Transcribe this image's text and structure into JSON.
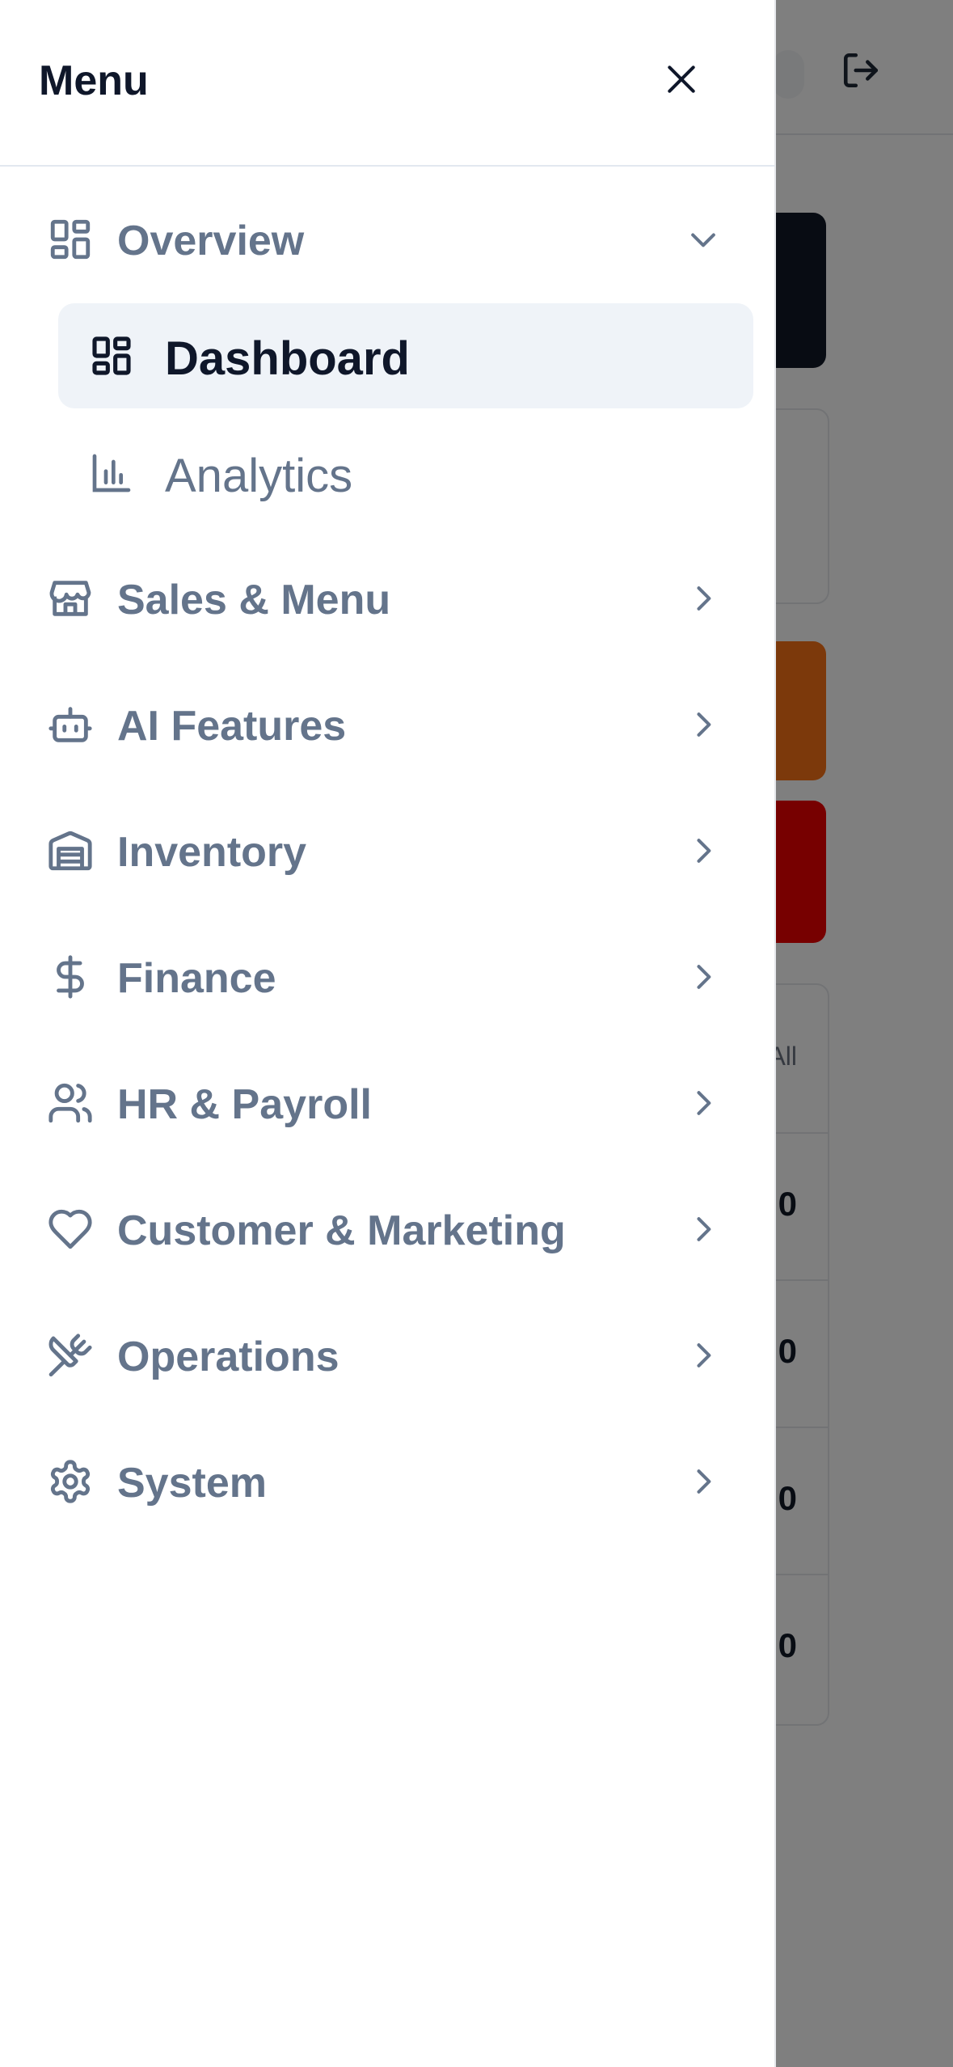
{
  "drawer": {
    "title": "Menu",
    "groups": [
      {
        "label": "Overview",
        "icon": "layout-grid-icon",
        "expanded": true,
        "items": [
          {
            "label": "Dashboard",
            "icon": "dashboard-icon",
            "active": true
          },
          {
            "label": "Analytics",
            "icon": "bar-chart-icon",
            "active": false
          }
        ]
      },
      {
        "label": "Sales & Menu",
        "icon": "store-icon",
        "expanded": false
      },
      {
        "label": "AI Features",
        "icon": "bot-icon",
        "expanded": false
      },
      {
        "label": "Inventory",
        "icon": "warehouse-icon",
        "expanded": false
      },
      {
        "label": "Finance",
        "icon": "dollar-icon",
        "expanded": false
      },
      {
        "label": "HR & Payroll",
        "icon": "users-icon",
        "expanded": false
      },
      {
        "label": "Customer & Marketing",
        "icon": "heart-icon",
        "expanded": false
      },
      {
        "label": "Operations",
        "icon": "utensils-crossed-icon",
        "expanded": false
      },
      {
        "label": "System",
        "icon": "settings-icon",
        "expanded": false
      }
    ]
  },
  "background": {
    "table_header": "All",
    "table_values": [
      "0",
      "0",
      "0",
      "0"
    ]
  },
  "colors": {
    "muted_text": "#64748b",
    "active_text": "#0f172a",
    "active_bg": "#eff3f8",
    "overlay": "rgba(0,0,0,0.5)"
  }
}
